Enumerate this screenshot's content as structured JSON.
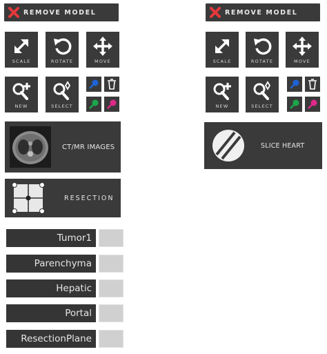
{
  "left": {
    "remove_model": "REMOVE MODEL",
    "tools": [
      {
        "label": "SCALE",
        "icon": "scale-icon"
      },
      {
        "label": "ROTATE",
        "icon": "rotate-icon"
      },
      {
        "label": "MOVE",
        "icon": "move-icon"
      },
      {
        "label": "NEW",
        "icon": "new-point-icon"
      },
      {
        "label": "SELECT",
        "icon": "select-point-icon"
      }
    ],
    "ct_mr_images": "CT/MR IMAGES",
    "resection": "RESECTION",
    "structures": [
      {
        "name": "Tumor1"
      },
      {
        "name": "Parenchyma"
      },
      {
        "name": "Hepatic"
      },
      {
        "name": "Portal"
      },
      {
        "name": "ResectionPlane"
      }
    ]
  },
  "right": {
    "remove_model": "REMOVE MODEL",
    "tools": [
      {
        "label": "SCALE"
      },
      {
        "label": "ROTATE"
      },
      {
        "label": "MOVE"
      },
      {
        "label": "NEW"
      },
      {
        "label": "SELECT"
      }
    ],
    "slice_heart": "SLICE HEART"
  },
  "colors": {
    "panel": "#3a3a3a",
    "remove_x": "#e5383b",
    "pin_blue": "#1e63d6",
    "pin_green": "#1aa84a",
    "pin_magenta": "#e0288a",
    "swatch": "#d0d0d0"
  }
}
